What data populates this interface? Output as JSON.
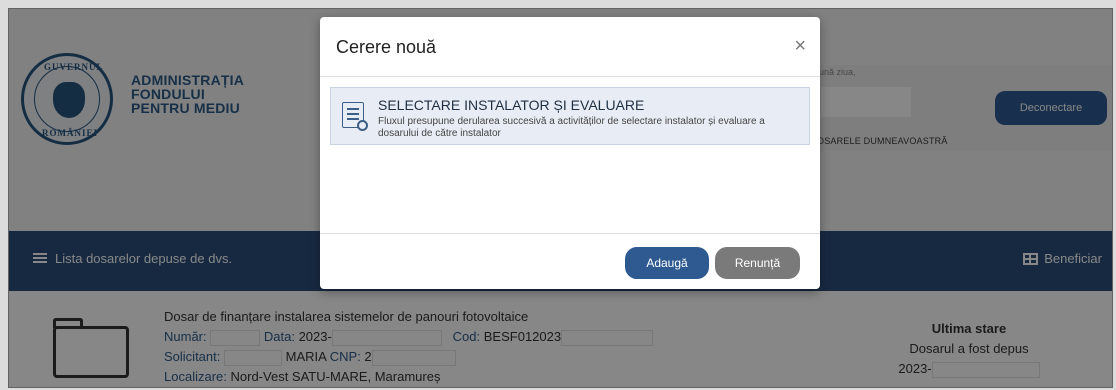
{
  "header": {
    "org_lines": [
      "ADMINISTRAȚIA",
      "FONDULUI",
      "PENTRU MEDIU"
    ],
    "logo_text_top": "GUVERNUL",
    "logo_text_bottom": "ROMÂNIEI",
    "greeting_partial": "ună ziua,",
    "dosare_text": "OSARELE DUMNEAVOASTRĂ",
    "logout_label": "Deconectare"
  },
  "nav": {
    "list_label": "Lista dosarelor depuse de dvs.",
    "beneficiar_label": "Beneficiar",
    "list_icon": "list-icon",
    "table_icon": "table-icon"
  },
  "record": {
    "title": "Dosar de finanțare instalarea sistemelor de panouri fotovoltaice",
    "numar_label": "Număr:",
    "data_label": "Data:",
    "data_value": "2023-",
    "cod_label": "Cod:",
    "cod_value": "BESF012023",
    "solicitant_label": "Solicitant:",
    "solicitant_value": "MARIA",
    "cnp_label": "CNP:",
    "cnp_value": "2",
    "localizare_label": "Localizare:",
    "localizare_value": "Nord-Vest SATU-MARE, Maramureș",
    "last_status_title": "Ultima stare",
    "last_status_text": "Dosarul a fost depus",
    "last_status_date": "2023-"
  },
  "modal": {
    "title": "Cerere nouă",
    "close_symbol": "×",
    "option_title": "SELECTARE INSTALATOR ȘI EVALUARE",
    "option_desc": "Fluxul presupune derularea succesivă a activităților de selectare instalator și evaluare a dosarului de către instalator",
    "add_label": "Adaugă",
    "cancel_label": "Renunță"
  },
  "colors": {
    "primary": "#2e5a91",
    "navbar": "#2c4f7b",
    "cancel_button": "#7a7a7a",
    "option_bg": "#e8edf5"
  }
}
